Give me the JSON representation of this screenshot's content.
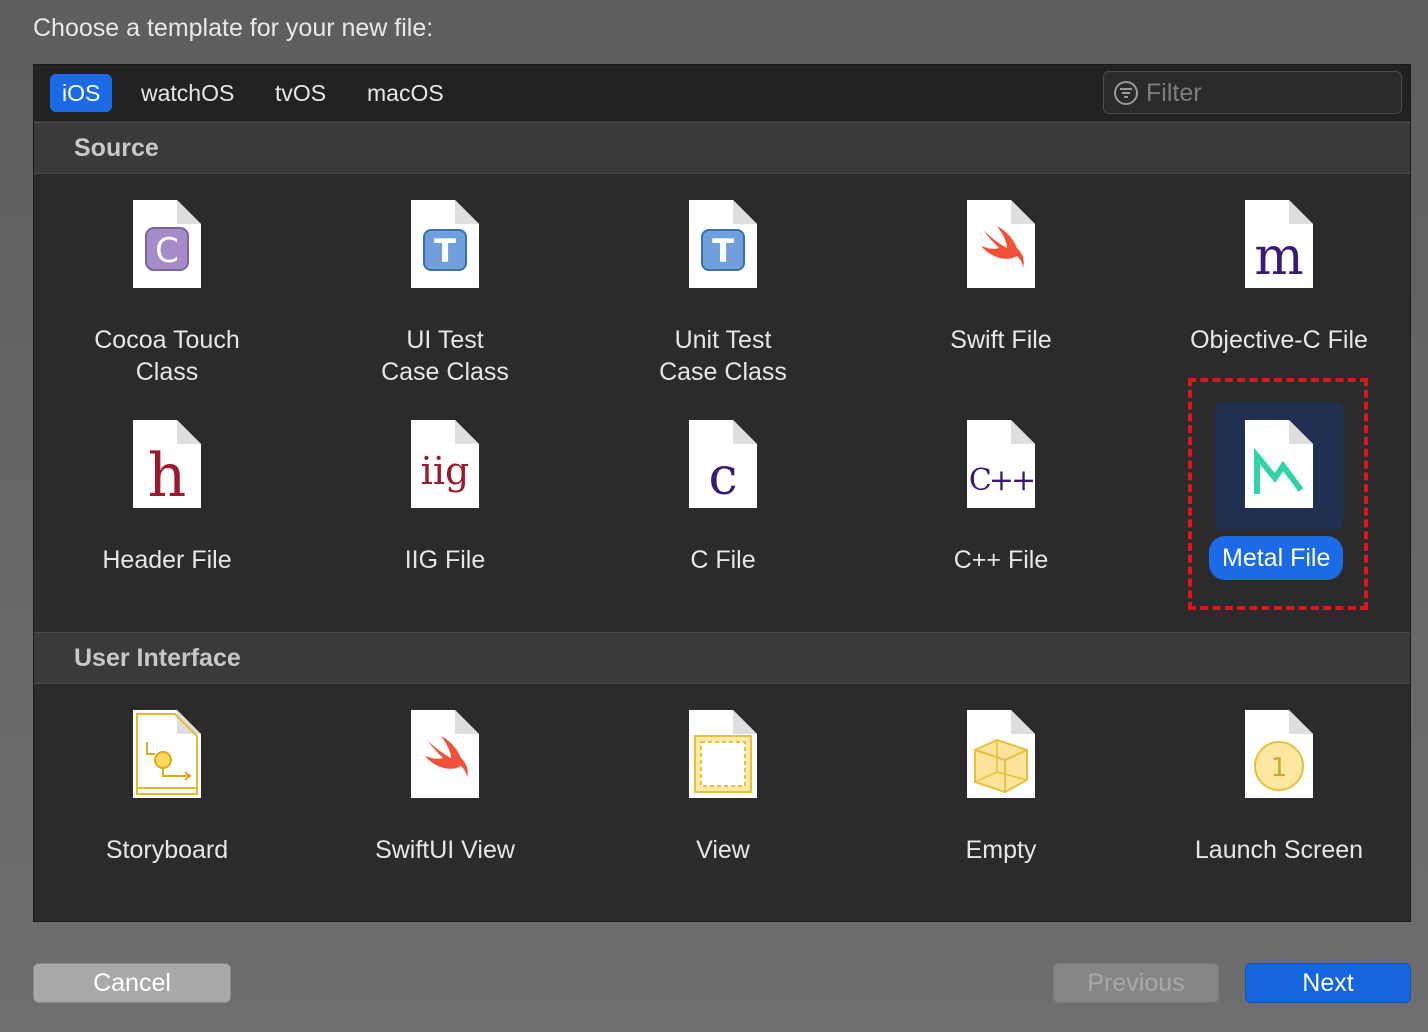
{
  "prompt": "Choose a template for your new file:",
  "tabs": [
    {
      "label": "iOS",
      "active": true
    },
    {
      "label": "watchOS",
      "active": false
    },
    {
      "label": "tvOS",
      "active": false
    },
    {
      "label": "macOS",
      "active": false
    }
  ],
  "filter": {
    "placeholder": "Filter",
    "value": ""
  },
  "sections": [
    {
      "title": "Source",
      "items": [
        {
          "label": "Cocoa Touch\nClass",
          "icon": "cocoa-touch-class-icon"
        },
        {
          "label": "UI Test\nCase Class",
          "icon": "ui-test-icon"
        },
        {
          "label": "Unit Test\nCase Class",
          "icon": "unit-test-icon"
        },
        {
          "label": "Swift File",
          "icon": "swift-icon"
        },
        {
          "label": "Objective-C File",
          "icon": "objective-c-icon"
        },
        {
          "label": "Header File",
          "icon": "header-file-icon"
        },
        {
          "label": "IIG File",
          "icon": "iig-file-icon"
        },
        {
          "label": "C File",
          "icon": "c-file-icon"
        },
        {
          "label": "C++ File",
          "icon": "cpp-file-icon"
        },
        {
          "label": "Metal File",
          "icon": "metal-file-icon",
          "selected": true
        }
      ]
    },
    {
      "title": "User Interface",
      "items": [
        {
          "label": "Storyboard",
          "icon": "storyboard-icon"
        },
        {
          "label": "SwiftUI View",
          "icon": "swiftui-icon"
        },
        {
          "label": "View",
          "icon": "view-icon"
        },
        {
          "label": "Empty",
          "icon": "empty-icon"
        },
        {
          "label": "Launch Screen",
          "icon": "launch-screen-icon"
        }
      ]
    }
  ],
  "icon_glyphs": {
    "cocoa": "C",
    "test": "T",
    "objc": "m",
    "header": "h",
    "iig": "iig",
    "c": "c",
    "cpp": "C++",
    "launch": "1"
  },
  "buttons": {
    "cancel": "Cancel",
    "previous": "Previous",
    "next": "Next"
  },
  "colors": {
    "accent": "#1c6be6",
    "highlight": "#e0141c"
  }
}
